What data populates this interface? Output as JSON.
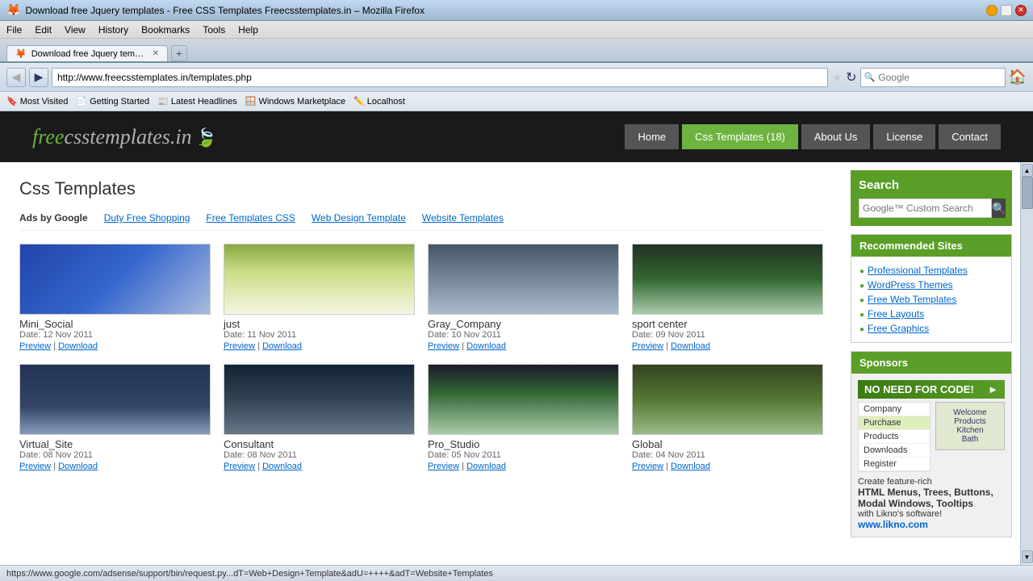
{
  "browser": {
    "titlebar": "Download free Jquery templates - Free CSS Templates Freecsstemplates.in – Mozilla Firefox",
    "favicon": "🦊",
    "tab_title": "Download free Jquery templates – Free CSS ...",
    "tab_close": "✕",
    "tab_new": "+",
    "nav": {
      "back": "◀",
      "forward": "▶",
      "address": "http://www.freecsstemplates.in/templates.php",
      "star": "★",
      "refresh": "↻",
      "search_placeholder": "Google",
      "home": "🏠"
    },
    "menu": [
      "File",
      "Edit",
      "View",
      "History",
      "Bookmarks",
      "Tools",
      "Help"
    ],
    "bookmarks": [
      {
        "label": "Most Visited",
        "icon": "🔖"
      },
      {
        "label": "Getting Started",
        "icon": "📄"
      },
      {
        "label": "Latest Headlines",
        "icon": "📰"
      },
      {
        "label": "Windows Marketplace",
        "icon": "🪟"
      },
      {
        "label": "Localhost",
        "icon": "✏️"
      }
    ],
    "status_bar": "https://www.google.com/adsense/support/bin/request.py...dT=Web+Design+Template&adU=++++&adT=Website+Templates"
  },
  "site": {
    "logo_free": "free",
    "logo_css": "csstemplates.in",
    "logo_leaf": "🍃",
    "nav": [
      {
        "label": "Home",
        "active": false
      },
      {
        "label": "Css Templates (18)",
        "active": true
      },
      {
        "label": "About Us",
        "active": false
      },
      {
        "label": "License",
        "active": false
      },
      {
        "label": "Contact",
        "active": false
      }
    ]
  },
  "page": {
    "title": "Css Templates",
    "ads": {
      "label": "Ads by Google",
      "links": [
        "Duty Free Shopping",
        "Free Templates CSS",
        "Web Design Template",
        "Website Templates"
      ]
    },
    "templates": [
      {
        "name": "Mini_Social",
        "date": "Date: 12 Nov 2011",
        "preview": "Preview",
        "download": "Download",
        "thumb_class": "thumb-mini-social"
      },
      {
        "name": "just",
        "date": "Date: 11 Nov 2011",
        "preview": "Preview",
        "download": "Download",
        "thumb_class": "thumb-just"
      },
      {
        "name": "Gray_Company",
        "date": "Date: 10 Nov 2011",
        "preview": "Preview",
        "download": "Download",
        "thumb_class": "thumb-gray-company"
      },
      {
        "name": "sport center",
        "date": "Date: 09 Nov 2011",
        "preview": "Preview",
        "download": "Download",
        "thumb_class": "thumb-sport-center"
      },
      {
        "name": "Virtual_Site",
        "date": "Date: 08 Nov 2011",
        "preview": "Preview",
        "download": "Download",
        "thumb_class": "thumb-virtual-site"
      },
      {
        "name": "Consultant",
        "date": "Date: 08 Nov 2011",
        "preview": "Preview",
        "download": "Download",
        "thumb_class": "thumb-consultant"
      },
      {
        "name": "Pro_Studio",
        "date": "Date: 05 Nov 2011",
        "preview": "Preview",
        "download": "Download",
        "thumb_class": "thumb-pro-studio"
      },
      {
        "name": "Global",
        "date": "Date: 04 Nov 2011",
        "preview": "Preview",
        "download": "Download",
        "thumb_class": "thumb-global"
      }
    ]
  },
  "sidebar": {
    "search": {
      "title": "Search",
      "placeholder": "Google™ Custom Search",
      "button": "🔍"
    },
    "recommended": {
      "title": "Recommended Sites",
      "links": [
        "Professional Templates",
        "WordPress Themes",
        "Free Web Templates",
        "Free Layouts",
        "Free Graphics"
      ]
    },
    "sponsors": {
      "title": "Sponsors",
      "ad_header": "NO NEED FOR CODE!",
      "ad_badge": "►",
      "ad_menu": [
        "Company",
        "Purchase",
        "Products",
        "Downloads",
        "Register"
      ],
      "ad_text1": "Create feature-rich",
      "ad_text2": "HTML Menus, Trees, Buttons,",
      "ad_text3": "Modal Windows, Tooltips",
      "ad_text4": "with Likno's software!",
      "ad_url": "www.likno.com"
    }
  }
}
